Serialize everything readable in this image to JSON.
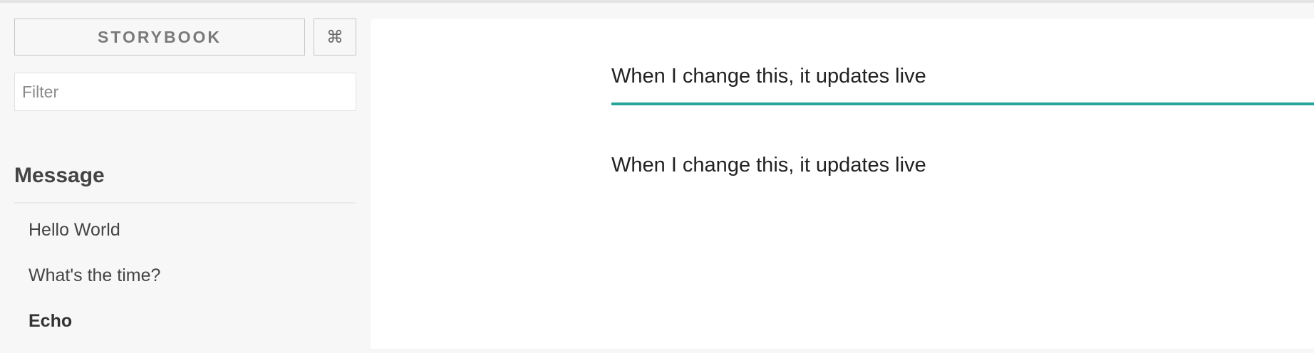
{
  "header": {
    "title": "STORYBOOK",
    "shortcut_icon": "⌘"
  },
  "search": {
    "placeholder": "Filter",
    "value": ""
  },
  "stories": {
    "kind": "Message",
    "items": [
      {
        "label": "Hello World",
        "selected": false
      },
      {
        "label": "What's the time?",
        "selected": false
      },
      {
        "label": "Echo",
        "selected": true
      }
    ]
  },
  "preview": {
    "input_value": "When I change this, it updates live",
    "output_text": "When I change this, it updates live"
  },
  "colors": {
    "accent": "#26a69a",
    "sidebar_bg": "#f7f7f7",
    "preview_bg": "#ffffff"
  }
}
